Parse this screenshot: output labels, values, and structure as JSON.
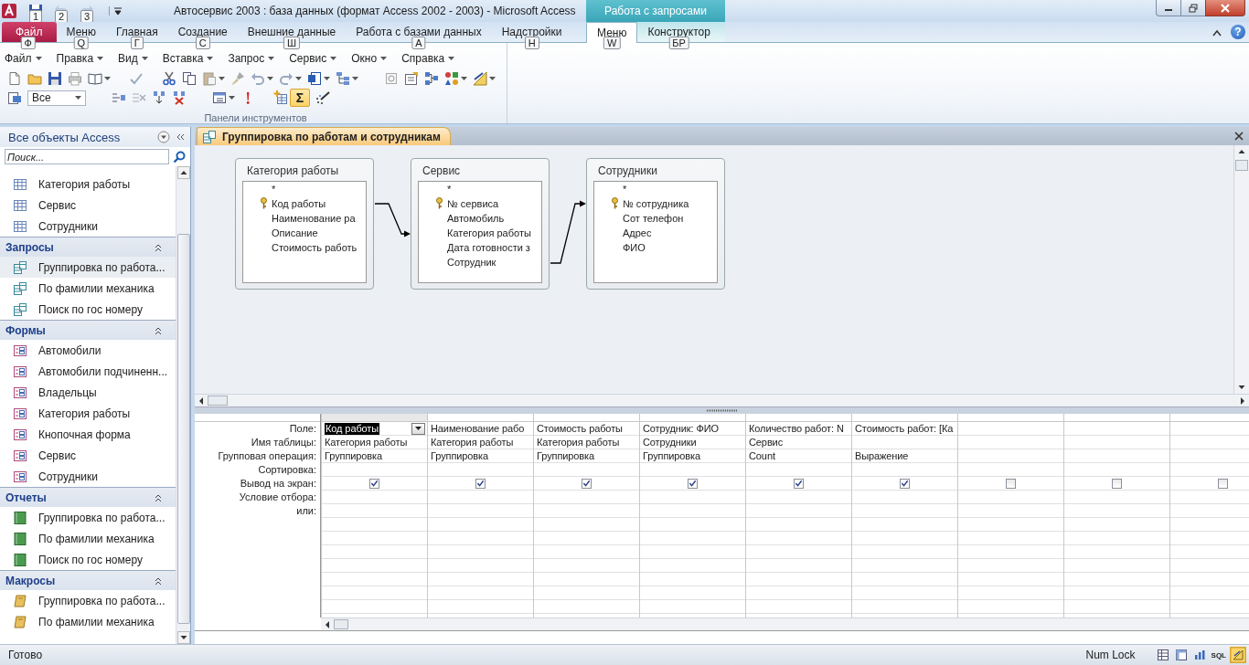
{
  "window": {
    "title": "Автосервис 2003 : база данных (формат Access 2002 - 2003)  -  Microsoft Access",
    "contextual_group": "Работа с запросами"
  },
  "quick_access": [
    {
      "keytip": "1",
      "disabled": false
    },
    {
      "keytip": "2",
      "disabled": true
    },
    {
      "keytip": "3",
      "disabled": true
    }
  ],
  "ribbon_tabs": [
    {
      "label": "Файл",
      "keytip": "Ф",
      "kind": "file",
      "selected": false
    },
    {
      "label": "Меню",
      "keytip": "Q",
      "kind": "tab",
      "selected": false
    },
    {
      "label": "Главная",
      "keytip": "Г",
      "kind": "tab",
      "selected": false
    },
    {
      "label": "Создание",
      "keytip": "С",
      "kind": "tab",
      "selected": false
    },
    {
      "label": "Внешние данные",
      "keytip": "Ш",
      "kind": "tab",
      "selected": false
    },
    {
      "label": "Работа с базами данных",
      "keytip": "А",
      "kind": "tab",
      "selected": false
    },
    {
      "label": "Надстройки",
      "keytip": "Н",
      "kind": "tab",
      "selected": false
    },
    {
      "label": "Меню",
      "keytip": "W",
      "kind": "contextual",
      "selected": true
    },
    {
      "label": "Конструктор",
      "keytip": "БР",
      "kind": "contextual",
      "selected": false
    }
  ],
  "help_button": "?",
  "menu_bar": [
    "Файл",
    "Правка",
    "Вид",
    "Вставка",
    "Запрос",
    "Сервис",
    "Окно",
    "Справка"
  ],
  "toolbar": {
    "filter_combo": "Все",
    "totals_button": {
      "label": "Σ",
      "on": true
    },
    "group_label": "Панели инструментов"
  },
  "navigation": {
    "title": "Все объекты Access",
    "search_placeholder": "Поиск...",
    "groups": [
      {
        "kind": "table",
        "items": [
          {
            "label": "Категория работы",
            "selected": false
          },
          {
            "label": "Сервис",
            "selected": false
          },
          {
            "label": "Сотрудники",
            "selected": false
          }
        ]
      },
      {
        "kind": "query",
        "header": "Запросы",
        "items": [
          {
            "label": "Группировка по работа...",
            "selected": true
          },
          {
            "label": "По фамилии механика",
            "selected": false
          },
          {
            "label": "Поиск по гос номеру",
            "selected": false
          }
        ]
      },
      {
        "kind": "form",
        "header": "Формы",
        "items": [
          {
            "label": "Автомобили",
            "selected": false
          },
          {
            "label": "Автомобили подчиненн...",
            "selected": false
          },
          {
            "label": "Владельцы",
            "selected": false
          },
          {
            "label": "Категория работы",
            "selected": false
          },
          {
            "label": "Кнопочная форма",
            "selected": false
          },
          {
            "label": "Сервис",
            "selected": false
          },
          {
            "label": "Сотрудники",
            "selected": false
          }
        ]
      },
      {
        "kind": "report",
        "header": "Отчеты",
        "items": [
          {
            "label": "Группировка по работа...",
            "selected": false
          },
          {
            "label": "По фамилии механика",
            "selected": false
          },
          {
            "label": "Поиск по гос номеру",
            "selected": false
          }
        ]
      },
      {
        "kind": "macro",
        "header": "Макросы",
        "items": [
          {
            "label": "Группировка по работа...",
            "selected": false
          },
          {
            "label": "По фамилии механика",
            "selected": false
          }
        ]
      }
    ]
  },
  "document": {
    "tab_title": "Группировка по работам и сотрудникам",
    "tables": [
      {
        "name": "Категория работы",
        "fields": [
          {
            "name": "*",
            "key": false
          },
          {
            "name": "Код работы",
            "key": true
          },
          {
            "name": "Наименование ра",
            "key": false
          },
          {
            "name": "Описание",
            "key": false
          },
          {
            "name": "Стоимость работь",
            "key": false
          }
        ]
      },
      {
        "name": "Сервис",
        "fields": [
          {
            "name": "*",
            "key": false
          },
          {
            "name": "№ сервиса",
            "key": true
          },
          {
            "name": "Автомобиль",
            "key": false
          },
          {
            "name": "Категория работы",
            "key": false
          },
          {
            "name": "Дата готовности з",
            "key": false
          },
          {
            "name": "Сотрудник",
            "key": false
          }
        ]
      },
      {
        "name": "Сотрудники",
        "fields": [
          {
            "name": "*",
            "key": false
          },
          {
            "name": "№ сотрудника",
            "key": true
          },
          {
            "name": "Сот телефон",
            "key": false
          },
          {
            "name": "Адрес",
            "key": false
          },
          {
            "name": "ФИО",
            "key": false
          }
        ]
      }
    ],
    "grid": {
      "row_labels": [
        "Поле:",
        "Имя таблицы:",
        "Групповая операция:",
        "Сортировка:",
        "Вывод на экран:",
        "Условие отбора:",
        "или:"
      ],
      "columns": [
        {
          "field": "Код работы",
          "table": "Категория работы",
          "total": "Группировка",
          "show": true,
          "selected": true
        },
        {
          "field": "Наименование рабо",
          "table": "Категория работы",
          "total": "Группировка",
          "show": true,
          "selected": false
        },
        {
          "field": "Стоимость работы",
          "table": "Категория работы",
          "total": "Группировка",
          "show": true,
          "selected": false
        },
        {
          "field": "Сотрудник: ФИО",
          "table": "Сотрудники",
          "total": "Группировка",
          "show": true,
          "selected": false
        },
        {
          "field": "Количество работ: N",
          "table": "Сервис",
          "total": "Count",
          "show": true,
          "selected": false
        },
        {
          "field": "Стоимость работ: [Ка",
          "total": "Выражение",
          "show": true,
          "selected": false
        },
        {
          "show": false,
          "selected": false
        },
        {
          "show": false,
          "selected": false
        },
        {
          "show": false,
          "selected": false
        }
      ]
    }
  },
  "status_bar": {
    "text": "Готово",
    "indicator": "Num Lock",
    "views": [
      {
        "kind": "datasheet",
        "selected": false
      },
      {
        "kind": "pivot-table",
        "selected": false
      },
      {
        "kind": "pivot-chart",
        "selected": false
      },
      {
        "kind": "sql",
        "label": "SQL",
        "selected": false
      },
      {
        "kind": "design",
        "selected": true
      }
    ]
  }
}
